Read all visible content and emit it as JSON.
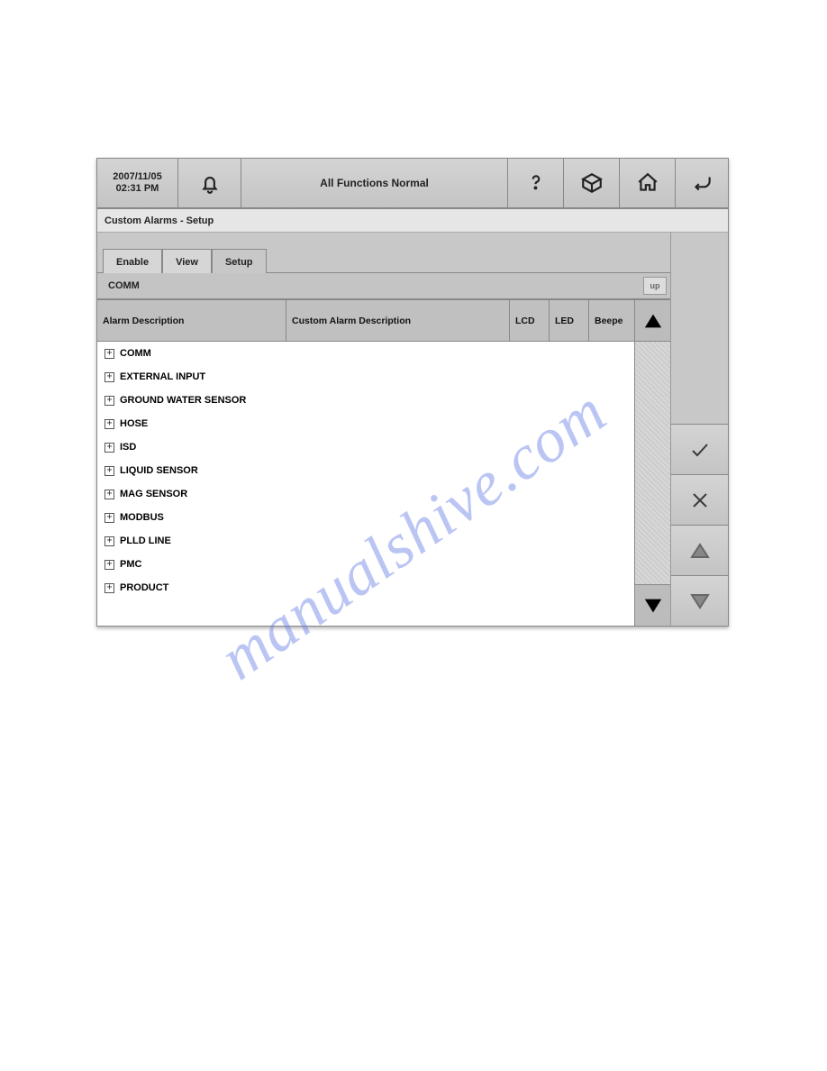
{
  "header": {
    "date": "2007/11/05",
    "time": "02:31 PM",
    "status": "All Functions Normal"
  },
  "subbar": {
    "title": "Custom Alarms - Setup"
  },
  "tabs": [
    {
      "label": "Enable",
      "active": false
    },
    {
      "label": "View",
      "active": false
    },
    {
      "label": "Setup",
      "active": true
    }
  ],
  "category": {
    "name": "COMM",
    "up_label": "up"
  },
  "columns": {
    "desc": "Alarm Description",
    "custom": "Custom Alarm Description",
    "lcd": "LCD",
    "led": "LED",
    "beep": "Beepe"
  },
  "rows": [
    {
      "label": "COMM"
    },
    {
      "label": "EXTERNAL INPUT"
    },
    {
      "label": "GROUND WATER SENSOR"
    },
    {
      "label": "HOSE"
    },
    {
      "label": "ISD"
    },
    {
      "label": "LIQUID SENSOR"
    },
    {
      "label": "MAG SENSOR"
    },
    {
      "label": "MODBUS"
    },
    {
      "label": "PLLD LINE"
    },
    {
      "label": "PMC"
    },
    {
      "label": "PRODUCT"
    }
  ],
  "watermark": "manualshive.com"
}
